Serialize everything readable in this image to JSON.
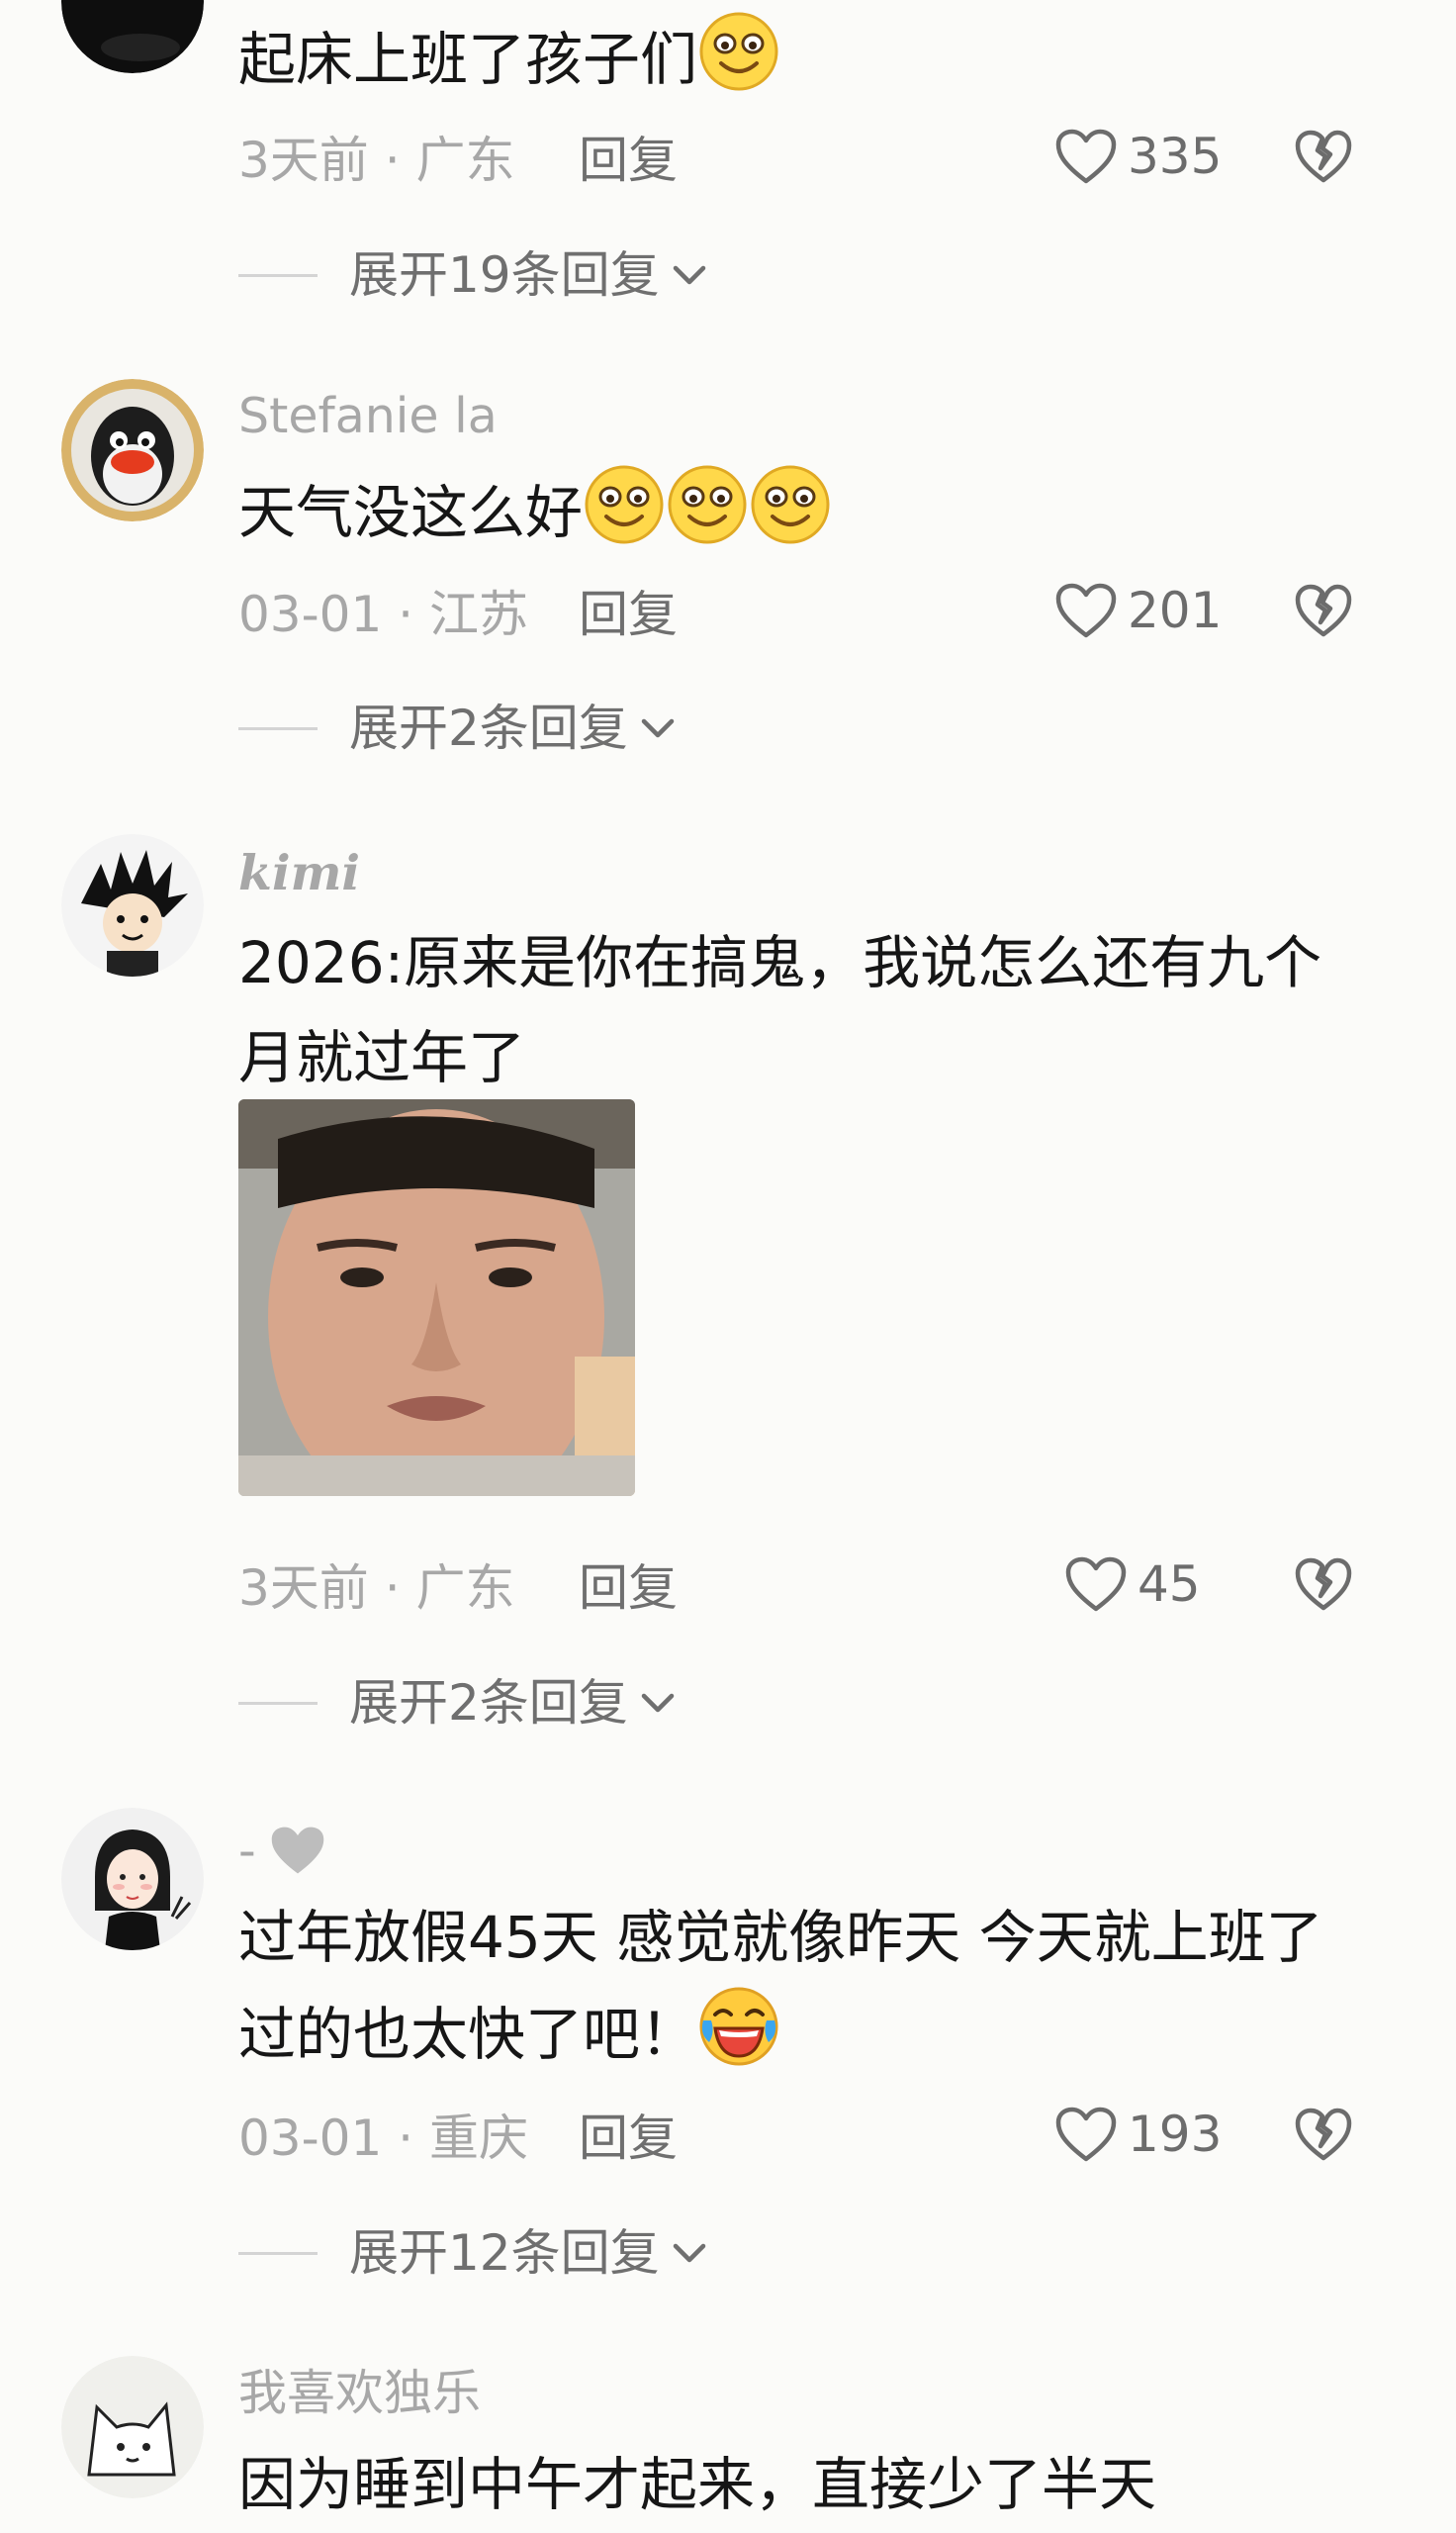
{
  "comments": [
    {
      "username": "",
      "text": "起床上班了孩子们",
      "meta": "3天前 · 广东",
      "reply": "回复",
      "likes": "335",
      "expand": "展开19条回复"
    },
    {
      "username": "Stefanie la",
      "text": "天气没这么好",
      "meta": "03-01 · 江苏",
      "reply": "回复",
      "likes": "201",
      "expand": "展开2条回复"
    },
    {
      "username": "kimi",
      "text_line1": "2026:原来是你在搞鬼，我说怎么还有九个",
      "text_line2": "月就过年了",
      "meta": "3天前 · 广东",
      "reply": "回复",
      "likes": "45",
      "expand": "展开2条回复"
    },
    {
      "username": "-",
      "text_line1": "过年放假45天 感觉就像昨天 今天就上班了",
      "text_line2": "过的也太快了吧！",
      "meta": "03-01 · 重庆",
      "reply": "回复",
      "likes": "193",
      "expand": "展开12条回复"
    },
    {
      "username": "我喜欢独乐",
      "text": "因为睡到中午才起来，直接少了半天"
    }
  ],
  "icons": {
    "like": "heart-outline-icon",
    "dislike": "broken-heart-icon",
    "expand": "chevron-down-icon",
    "smile_emoji": "smile-emoji-icon",
    "laugh_cry_emoji": "laugh-cry-emoji-icon",
    "gray_heart": "gray-heart-icon"
  },
  "colors": {
    "background": "#fbfbf9",
    "meta_text": "#a7a7a7",
    "action_text": "#6f6f6f",
    "emoji_yellow": "#ffd84a"
  }
}
